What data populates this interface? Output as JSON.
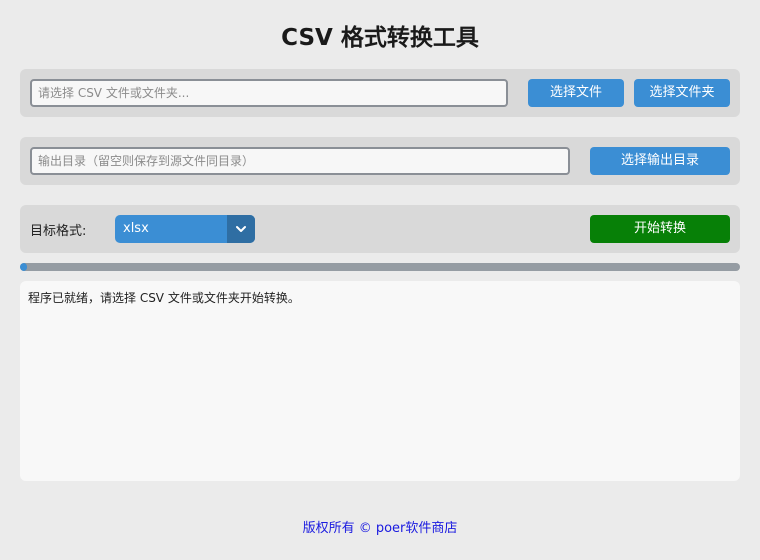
{
  "app": {
    "title": "CSV 格式转换工具"
  },
  "source": {
    "placeholder": "请选择 CSV 文件或文件夹...",
    "value": "",
    "select_file_label": "选择文件",
    "select_folder_label": "选择文件夹"
  },
  "output": {
    "placeholder": "输出目录（留空则保存到源文件同目录）",
    "value": "",
    "select_output_label": "选择输出目录"
  },
  "format": {
    "label": "目标格式:",
    "selected": "xlsx",
    "start_label": "开始转换"
  },
  "progress": {
    "fraction": 0.01
  },
  "log": {
    "text": "程序已就绪，请选择 CSV 文件或文件夹开始转换。"
  },
  "footer": {
    "text": "版权所有 © poer软件商店"
  },
  "colors": {
    "accent": "#3b8ed4",
    "start_button": "#078007",
    "link": "#1a1ae0"
  }
}
